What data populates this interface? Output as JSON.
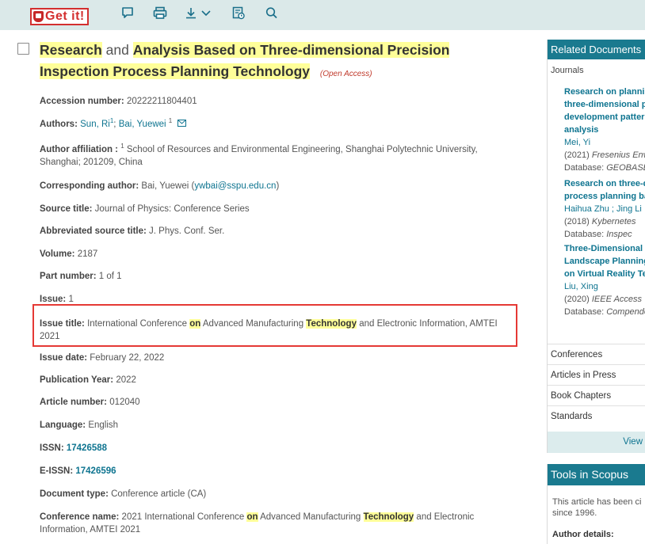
{
  "toolbar": {
    "getit_label": "Get it!",
    "icons": [
      "comment-icon",
      "print-icon",
      "download-icon",
      "chevron-down-icon",
      "export-icon",
      "search-icon"
    ]
  },
  "record": {
    "title_parts": {
      "w1": "Research",
      "w2": " and ",
      "w3": "Analysis Based on Three-dimensional Precision Inspection Process Planning Technology"
    },
    "open_access": "(Open Access)",
    "fields": {
      "accession": {
        "label": "Accession number:",
        "value": "20222211804401"
      },
      "authors": {
        "label": "Authors:",
        "a1": "Sun, Ri",
        "sep": ";",
        "a2": "Bai, Yuewei",
        "sup": "1"
      },
      "affiliation": {
        "label": "Author affiliation :",
        "sup": "1",
        "value": "School of Resources and Environmental Engineering, Shanghai Polytechnic University, Shanghai; 201209, China"
      },
      "corresponding": {
        "label": "Corresponding author:",
        "name": "Bai, Yuewei",
        "email": "ywbai@sspu.edu.cn"
      },
      "source": {
        "label": "Source title:",
        "value": "Journal of Physics: Conference Series"
      },
      "abbr_source": {
        "label": "Abbreviated source title:",
        "value": "J. Phys. Conf. Ser."
      },
      "volume": {
        "label": "Volume:",
        "value": "2187"
      },
      "part": {
        "label": "Part number:",
        "value": "1 of 1"
      },
      "issue": {
        "label": "Issue:",
        "value": "1"
      },
      "issue_title": {
        "label": "Issue title:",
        "p1": "International Conference",
        "hl1": "on",
        "p2": "Advanced Manufacturing",
        "hl2": "Technology",
        "p3": "and Electronic Information, AMTEI 2021"
      },
      "issue_date": {
        "label": "Issue date:",
        "value": "February 22, 2022"
      },
      "pub_year": {
        "label": "Publication Year:",
        "value": "2022"
      },
      "article_number": {
        "label": "Article number:",
        "value": "012040"
      },
      "language": {
        "label": "Language:",
        "value": "English"
      },
      "issn": {
        "label": "ISSN:",
        "value": "17426588"
      },
      "eissn": {
        "label": "E-ISSN:",
        "value": "17426596"
      },
      "doc_type": {
        "label": "Document type:",
        "value": "Conference article (CA)"
      },
      "conf_name": {
        "label": "Conference name:",
        "p1": "2021 International Conference",
        "hl1": "on",
        "p2": "Advanced Manufacturing",
        "hl2": "Technology",
        "p3": "and Electronic Information, AMTEI 2021"
      }
    }
  },
  "sidebar": {
    "header": "Related Documents",
    "journals_label": "Journals",
    "items": [
      {
        "title_lines": [
          "Research on planning",
          "three-dimensional pr",
          "development pattern",
          "analysis"
        ],
        "author": "Mei, Yi",
        "year": "(2021)",
        "source": "Fresenius Enviro",
        "db_label": "Database:",
        "db": "GEOBASE"
      },
      {
        "title_lines": [
          "Research on three-d",
          "process planning ba"
        ],
        "author": "Haihua Zhu ; Jing Li",
        "year": "(2018)",
        "source": "Kybernetes",
        "db_label": "Database:",
        "db": "Inspec"
      },
      {
        "title_lines": [
          "Three-Dimensional",
          "Landscape Planning",
          "on Virtual Reality Te"
        ],
        "author": "Liu, Xing",
        "year": "(2020)",
        "source": "IEEE Access",
        "db_label": "Database:",
        "db": "Compendex"
      }
    ],
    "categories": [
      "Conferences",
      "Articles in Press",
      "Book Chapters",
      "Standards"
    ],
    "view_all": "View"
  },
  "tools": {
    "header": "Tools in Scopus",
    "line1": "This article has been ci",
    "line2": "since 1996.",
    "detail": "Author details:"
  }
}
